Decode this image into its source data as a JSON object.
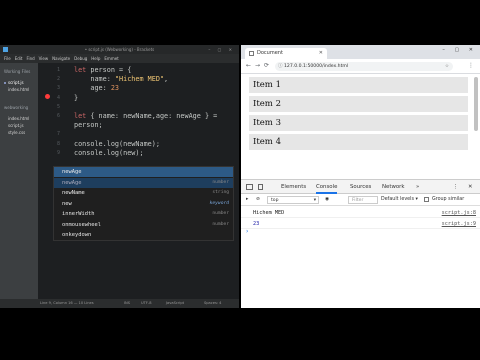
{
  "editor": {
    "title": "• script.js (Webworking) - Brackets",
    "menu": [
      "File",
      "Edit",
      "Find",
      "View",
      "Navigate",
      "Debug",
      "Help",
      "Emmet"
    ],
    "sidebar": {
      "working_files_title": "Working Files",
      "working_files": [
        "script.js",
        "index.html"
      ],
      "project_title": "webworking",
      "project_files": [
        "index.html",
        "script.js",
        "style.css"
      ]
    },
    "lines": [
      {
        "n": "1",
        "parts": [
          {
            "t": "let ",
            "c": "kw"
          },
          {
            "t": "person = {",
            "c": "prop"
          }
        ]
      },
      {
        "n": "2",
        "parts": [
          {
            "t": "    name: ",
            "c": "prop"
          },
          {
            "t": "\"Hichem MED\"",
            "c": "str"
          },
          {
            "t": ",",
            "c": "prop"
          }
        ]
      },
      {
        "n": "3",
        "parts": [
          {
            "t": "    age: ",
            "c": "prop"
          },
          {
            "t": "23",
            "c": "num"
          }
        ]
      },
      {
        "n": "4",
        "parts": [
          {
            "t": "}",
            "c": "prop"
          }
        ]
      },
      {
        "n": "5",
        "parts": [
          {
            "t": "",
            "c": "prop"
          }
        ]
      },
      {
        "n": "6",
        "parts": [
          {
            "t": "let ",
            "c": "kw"
          },
          {
            "t": "{ name: newName,age: newAge } =",
            "c": "prop"
          }
        ]
      },
      {
        "n": "",
        "parts": [
          {
            "t": "person;",
            "c": "prop"
          }
        ]
      },
      {
        "n": "7",
        "parts": [
          {
            "t": "",
            "c": "prop"
          }
        ]
      },
      {
        "n": "8",
        "parts": [
          {
            "t": "console.log(newName);",
            "c": "prop"
          }
        ]
      },
      {
        "n": "9",
        "parts": [
          {
            "t": "console.log(new);",
            "c": "prop"
          }
        ]
      }
    ],
    "hints": [
      {
        "label": "newAge",
        "type": ""
      },
      {
        "label": "newAge",
        "type": "number"
      },
      {
        "label": "newName",
        "type": "string"
      },
      {
        "label": "new",
        "type": "keyword"
      },
      {
        "label": "innerWidth",
        "type": "number"
      },
      {
        "label": "onmousewheel",
        "type": "number"
      },
      {
        "label": "onkeydown",
        "type": ""
      }
    ],
    "status": {
      "position": "Line 9, Column 16 — 10 Lines",
      "ins": "INS",
      "encoding": "UTF-8",
      "language": "JavaScript",
      "spaces": "Spaces: 4"
    }
  },
  "browser": {
    "tab_title": "Document",
    "url": "127.0.0.1:50000/index.html",
    "items": [
      "Item 1",
      "Item 2",
      "Item 3",
      "Item 4"
    ],
    "devtools": {
      "tabs": [
        "Elements",
        "Console",
        "Sources",
        "Network"
      ],
      "more": "»",
      "context": "top",
      "filter_placeholder": "Filter",
      "levels": "Default levels ▾",
      "group_similar": "Group similar",
      "logs": [
        {
          "message": "Hichem MED",
          "source": "script.js:8",
          "kind": "string"
        },
        {
          "message": "23",
          "source": "script.js:9",
          "kind": "number"
        }
      ],
      "prompt": "›"
    }
  }
}
